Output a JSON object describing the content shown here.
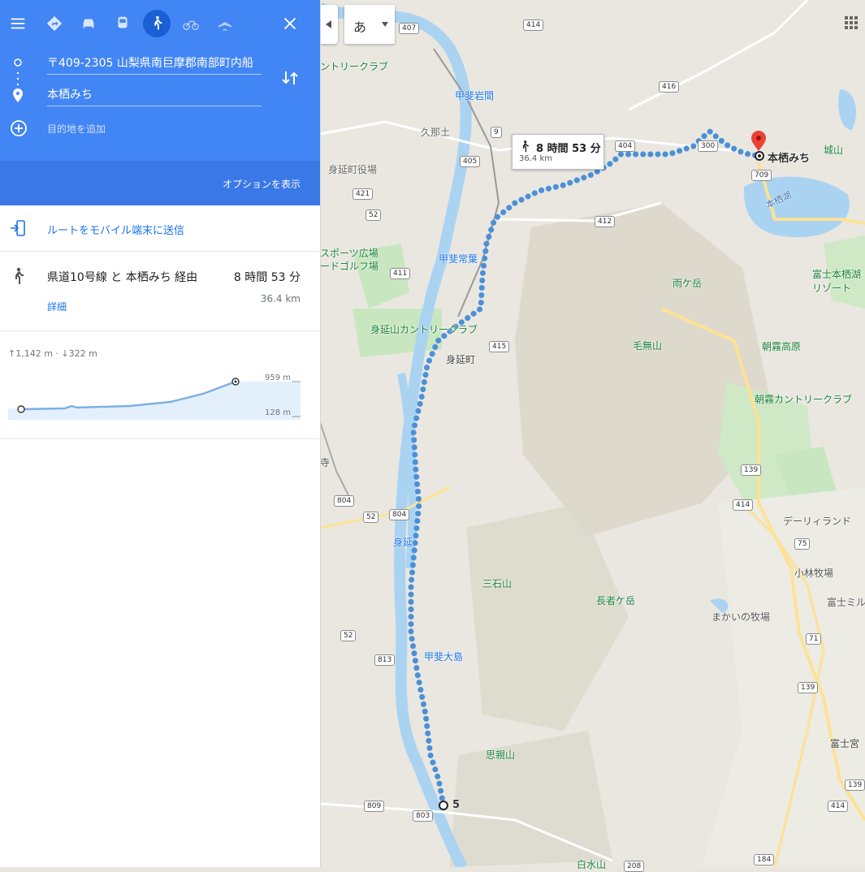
{
  "header": {
    "destination_marker_label": "本栖みち",
    "origin_input": "〒409-2305 山梨県南巨摩郡南部町内船",
    "destination_input": "本栖みち",
    "add_destination_placeholder": "目的地を追加",
    "options_label": "オプションを表示"
  },
  "send_route": {
    "label": "ルートをモバイル端末に送信"
  },
  "route": {
    "via": "県道10号線 と 本栖みち 経由",
    "duration": "8 時間 53 分",
    "distance": "36.4 km",
    "details_label": "詳細"
  },
  "elevation": {
    "summary": "↑1,142 m · ↓322 m",
    "max_label": "959 m",
    "min_label": "128 m"
  },
  "map": {
    "ime_label": "あ",
    "callout_duration": "8 時間 53 分",
    "callout_distance": "36.4 km",
    "start_label": "5",
    "end_label": "本栖みち",
    "labels": [
      "甲斐岩間",
      "久那土",
      "身延町役場",
      "甲斐常葉",
      "身延山カントリークラブ",
      "身延町",
      "身延",
      "甲斐大島",
      "三石山",
      "長者ケ岳",
      "思親山",
      "毛無山",
      "雨ケ岳",
      "朝霧高原",
      "朝霧カントリークラブ",
      "デーリィランド",
      "小林牧場",
      "富士ミル",
      "まかいの牧場",
      "富士宮",
      "城山",
      "本栖湖",
      "富士本栖湖リゾート",
      "ントリークラブ",
      "スポーツ広場",
      "ードゴルフ場",
      "寺",
      "白水山"
    ],
    "road_numbers": [
      "407",
      "414",
      "416",
      "405",
      "9",
      "404",
      "300",
      "709",
      "421",
      "52",
      "412",
      "411",
      "415",
      "139",
      "804",
      "52",
      "804",
      "75",
      "71",
      "813",
      "52",
      "139",
      "809",
      "803",
      "139",
      "414",
      "184",
      "414",
      "208"
    ]
  },
  "colors": {
    "header_blue": "#4285f4",
    "route_blue": "#1a73e8",
    "destination_red": "#ea4335"
  }
}
